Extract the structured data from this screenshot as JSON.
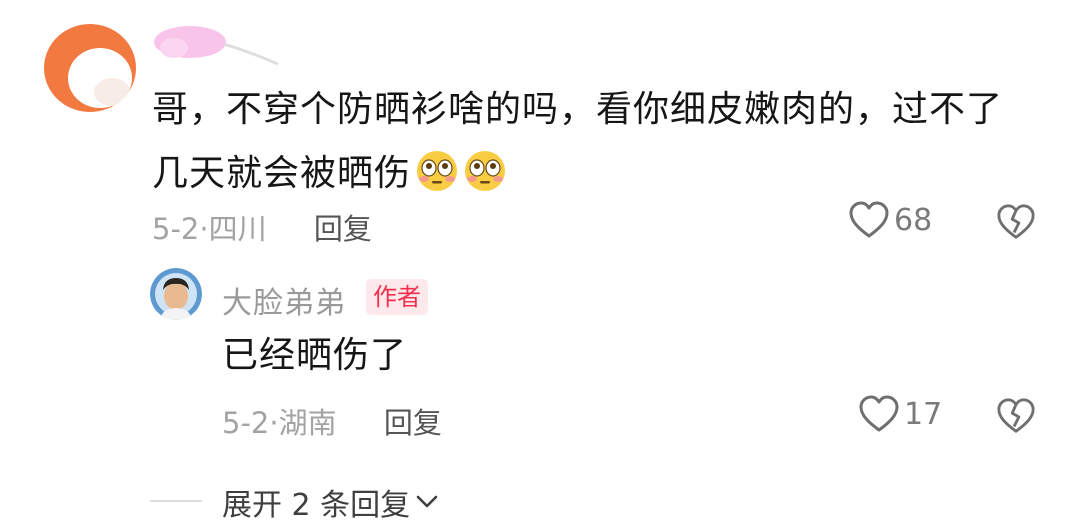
{
  "comment": {
    "text_line1": "哥，不穿个防晒衫啥的吗，看你细皮嫩肉的，过不了",
    "text_line2": "几天就会被晒伤",
    "emoji_icons": [
      "flushed-face-emoji",
      "flushed-face-emoji"
    ],
    "date": "5-2",
    "location": "四川",
    "reply_label": "回复",
    "like_count": "68"
  },
  "reply": {
    "username": "大脸弟弟",
    "badge": "作者",
    "text": "已经晒伤了",
    "date": "5-2",
    "location": "湖南",
    "reply_label": "回复",
    "like_count": "17"
  },
  "expand": {
    "label": "展开 2 条回复"
  },
  "colors": {
    "badge_text": "#f2304e",
    "badge_bg": "#fde8ec",
    "avatar_orange": "#f2793f",
    "name_blur_pink": "#f9c4ea"
  }
}
